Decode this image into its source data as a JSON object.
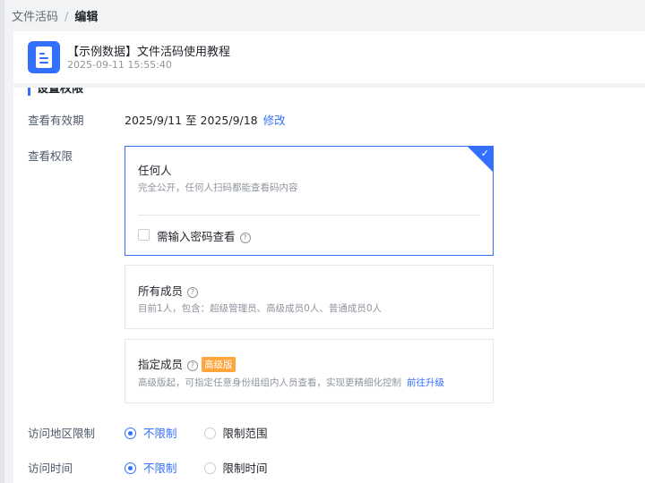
{
  "breadcrumb": {
    "parent": "文件活码",
    "separator": "/",
    "current": "编辑"
  },
  "document": {
    "title": "【示例数据】文件活码使用教程",
    "timestamp": "2025-09-11 15:55:40",
    "icon": "document-icon",
    "icon_color": "#3370ff"
  },
  "section": {
    "title": "设置权限"
  },
  "validity": {
    "label": "查看有效期",
    "range": "2025/9/11 至 2025/9/18",
    "edit_link": "修改"
  },
  "permission": {
    "label": "查看权限",
    "options": [
      {
        "title": "任何人",
        "desc": "完全公开，任何人扫码都能查看码内容",
        "selected": true,
        "password_label": "需输入密码查看"
      },
      {
        "title": "所有成员",
        "desc": "目前1人，包含：超级管理员、高级成员0人、普通成员0人"
      },
      {
        "title": "指定成员",
        "badge": "高级版",
        "desc": "高级版起，可指定任意身份组组内人员查看，实现更精细化控制",
        "upgrade_link": "前往升级"
      }
    ]
  },
  "region_limit": {
    "label": "访问地区限制",
    "options": [
      "不限制",
      "限制范围"
    ],
    "selected": 0
  },
  "time_limit": {
    "label": "访问时间",
    "options": [
      "不限制",
      "限制时间"
    ],
    "selected": 0
  },
  "colors": {
    "accent": "#3370ff",
    "badge": "#ffa53b"
  }
}
